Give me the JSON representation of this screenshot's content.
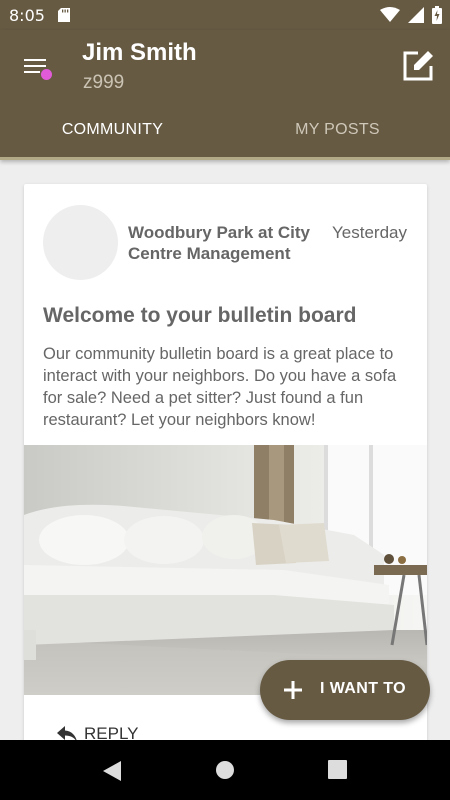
{
  "status_bar": {
    "time": "8:05"
  },
  "header": {
    "user_name": "Jim Smith",
    "user_id": "z999"
  },
  "tabs": [
    {
      "label": "COMMUNITY",
      "active": true
    },
    {
      "label": "MY POSTS",
      "active": false
    }
  ],
  "post": {
    "author": "Woodbury Park at City Centre Management",
    "date": "Yesterday",
    "title": "Welcome to your bulletin board",
    "body": "Our community bulletin board is a great place to interact with your neighbors.  Do you have a sofa for sale?  Need a pet sitter?  Just found a fun restaurant?  Let your neighbors know!",
    "reply_label": "REPLY"
  },
  "fab": {
    "label": "I WANT TO"
  },
  "colors": {
    "primary": "#665a43",
    "badge": "#e15bd8",
    "text_secondary": "#666666"
  }
}
